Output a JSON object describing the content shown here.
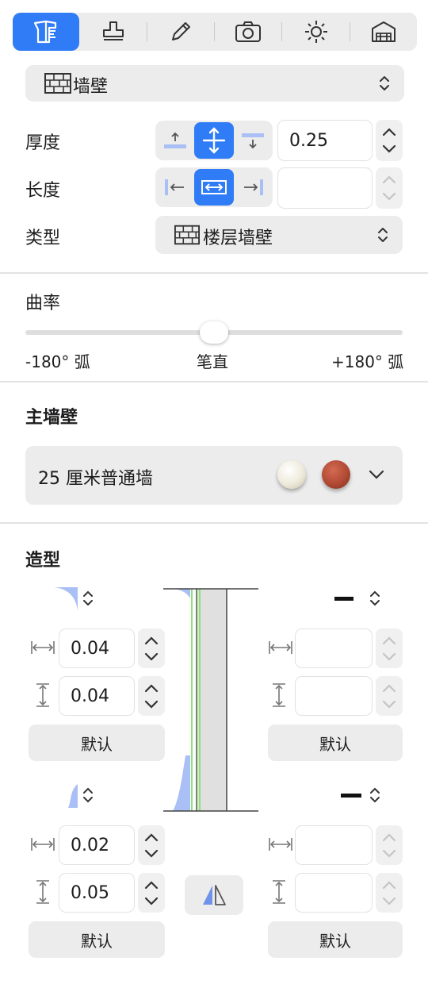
{
  "toolbar": {
    "tabs": [
      {
        "icon": "wall-tool-icon",
        "active": true
      },
      {
        "icon": "stamp-icon"
      },
      {
        "icon": "pencil-icon"
      },
      {
        "icon": "camera-icon"
      },
      {
        "icon": "sun-icon"
      },
      {
        "icon": "building-icon"
      }
    ]
  },
  "object_type": {
    "label": "墙壁"
  },
  "thickness": {
    "label": "厚度",
    "value": "0.25"
  },
  "length": {
    "label": "长度",
    "value": ""
  },
  "type": {
    "label": "类型",
    "value": "楼层墙壁"
  },
  "curvature": {
    "label": "曲率",
    "min_label": "-180° 弧",
    "mid_label": "笔直",
    "max_label": "+180° 弧",
    "value": 0.5
  },
  "main_wall": {
    "heading": "主墙壁",
    "material": "25 厘米普通墙",
    "swatch_colors": [
      "#eeeadb",
      "#b04a34"
    ]
  },
  "profile": {
    "heading": "造型",
    "top_left": {
      "width": "0.04",
      "height": "0.04",
      "default_label": "默认"
    },
    "top_right": {
      "width": "",
      "height": "",
      "default_label": "默认"
    },
    "bottom_left": {
      "width": "0.02",
      "height": "0.05",
      "default_label": "默认"
    },
    "bottom_right": {
      "width": "",
      "height": "",
      "default_label": "默认"
    }
  },
  "colors": {
    "accent": "#2f7cf6",
    "control_bg": "#ececec",
    "profile_fill": "#a9bff5",
    "core_fill": "#e0e0e0",
    "green_line": "#8de07a"
  }
}
